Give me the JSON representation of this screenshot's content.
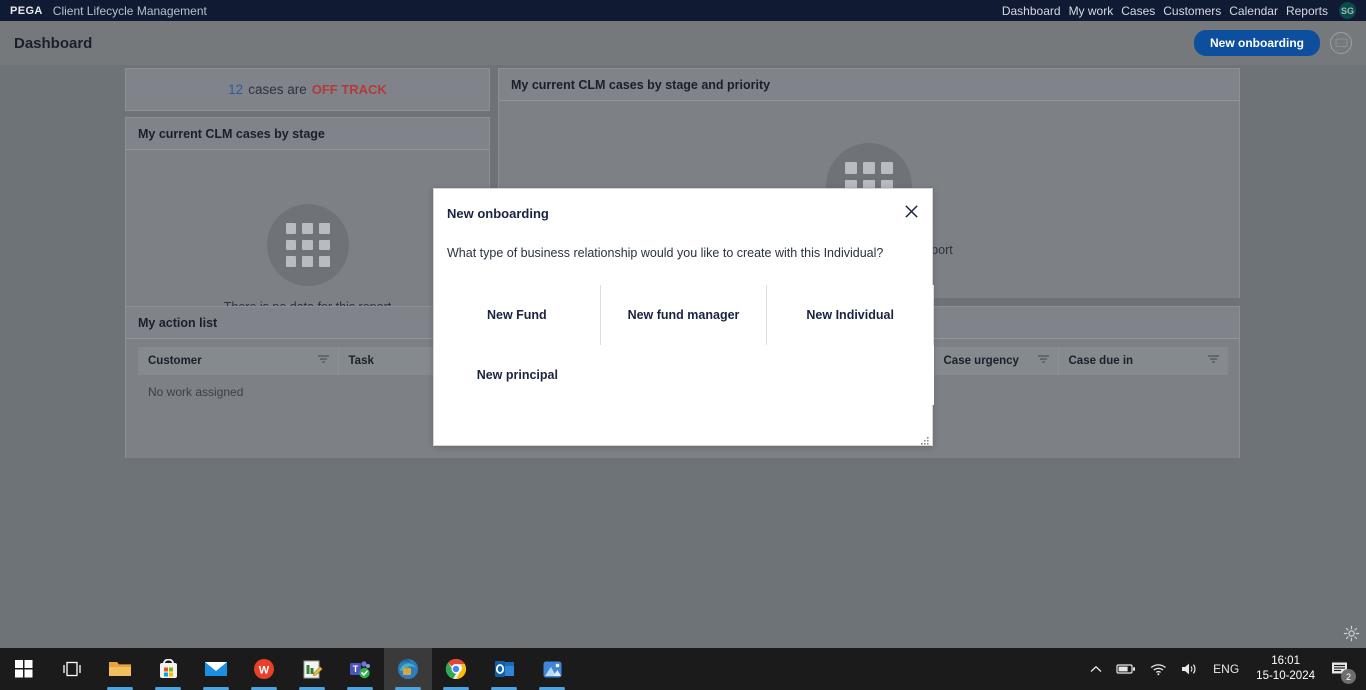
{
  "brandbar": {
    "logo": "PEGA",
    "app_name": "Client Lifecycle Management",
    "nav": [
      {
        "label": "Dashboard"
      },
      {
        "label": "My work"
      },
      {
        "label": "Cases"
      },
      {
        "label": "Customers"
      },
      {
        "label": "Calendar"
      },
      {
        "label": "Reports"
      }
    ],
    "avatar_initials": "SG",
    "avatar_color": "#0b4a4a",
    "background_color": "#111a33"
  },
  "pageheader": {
    "title": "Dashboard",
    "new_onboarding_label": "New onboarding",
    "primary_color": "#0d4f9c",
    "chat_icon": "chat-bubble-icon"
  },
  "dashboard": {
    "offtrack": {
      "count": "12",
      "middle_text": "cases are",
      "status": "OFF TRACK",
      "count_color": "#2f5b9e",
      "status_color": "#b33a3a"
    },
    "by_stage": {
      "title": "My current CLM cases by stage",
      "empty_text": "There is no data for this report",
      "empty_icon": "no-data-grid-icon"
    },
    "by_stage_priority": {
      "title": "My current CLM cases by stage and priority",
      "empty_text": "There is no data for this report",
      "empty_icon": "no-data-grid-icon"
    },
    "action_list": {
      "title": "My action list",
      "columns": [
        {
          "label": "Customer",
          "filter_icon": "filter-icon"
        },
        {
          "label": "Task",
          "filter_icon": "filter-icon"
        },
        {
          "label": "Case urgency",
          "filter_icon": "filter-icon"
        },
        {
          "label": "Case due in",
          "filter_icon": "filter-icon"
        }
      ],
      "empty_row": "No work assigned"
    }
  },
  "modal": {
    "title": "New onboarding",
    "close_icon": "close-icon",
    "question": "What type of business relationship would you like to create with this Individual?",
    "options": [
      {
        "label": "New Fund"
      },
      {
        "label": "New fund manager"
      },
      {
        "label": "New Individual"
      },
      {
        "label": "New principal"
      }
    ],
    "resize_handle": "resize-grip-icon"
  },
  "app_settings": {
    "gear_icon": "gear-icon"
  },
  "taskbar": {
    "items": [
      {
        "name": "start-button",
        "icon": "windows-logo-icon",
        "active": false,
        "underline": ""
      },
      {
        "name": "task-view-button",
        "icon": "task-view-icon",
        "active": false,
        "underline": ""
      },
      {
        "name": "file-explorer",
        "icon": "folder-icon",
        "active": false,
        "underline": "#4da3e0"
      },
      {
        "name": "microsoft-store",
        "icon": "store-icon",
        "active": false,
        "underline": ""
      },
      {
        "name": "mail",
        "icon": "mail-icon",
        "active": false,
        "underline": ""
      },
      {
        "name": "wps-office",
        "icon": "wps-icon",
        "active": false,
        "underline": "#4da3e0"
      },
      {
        "name": "notepad-editor",
        "icon": "editor-icon",
        "active": false,
        "underline": "#4da3e0"
      },
      {
        "name": "microsoft-teams",
        "icon": "teams-icon",
        "active": false,
        "underline": "#4da3e0"
      },
      {
        "name": "microsoft-edge",
        "icon": "edge-icon",
        "active": true,
        "underline": "#4da3e0"
      },
      {
        "name": "google-chrome",
        "icon": "chrome-icon",
        "active": false,
        "underline": "#4da3e0"
      },
      {
        "name": "microsoft-outlook",
        "icon": "outlook-icon",
        "active": false,
        "underline": "#4da3e0"
      },
      {
        "name": "photos",
        "icon": "photos-icon",
        "active": false,
        "underline": "#4da3e0"
      }
    ],
    "tray": {
      "chevron_icon": "chevron-up-icon",
      "battery_icon": "battery-icon",
      "wifi_icon": "wifi-icon",
      "volume_icon": "volume-icon",
      "language": "ENG",
      "time": "16:01",
      "date": "15-10-2024",
      "notification_icon": "notification-icon",
      "notification_count": "2"
    }
  }
}
